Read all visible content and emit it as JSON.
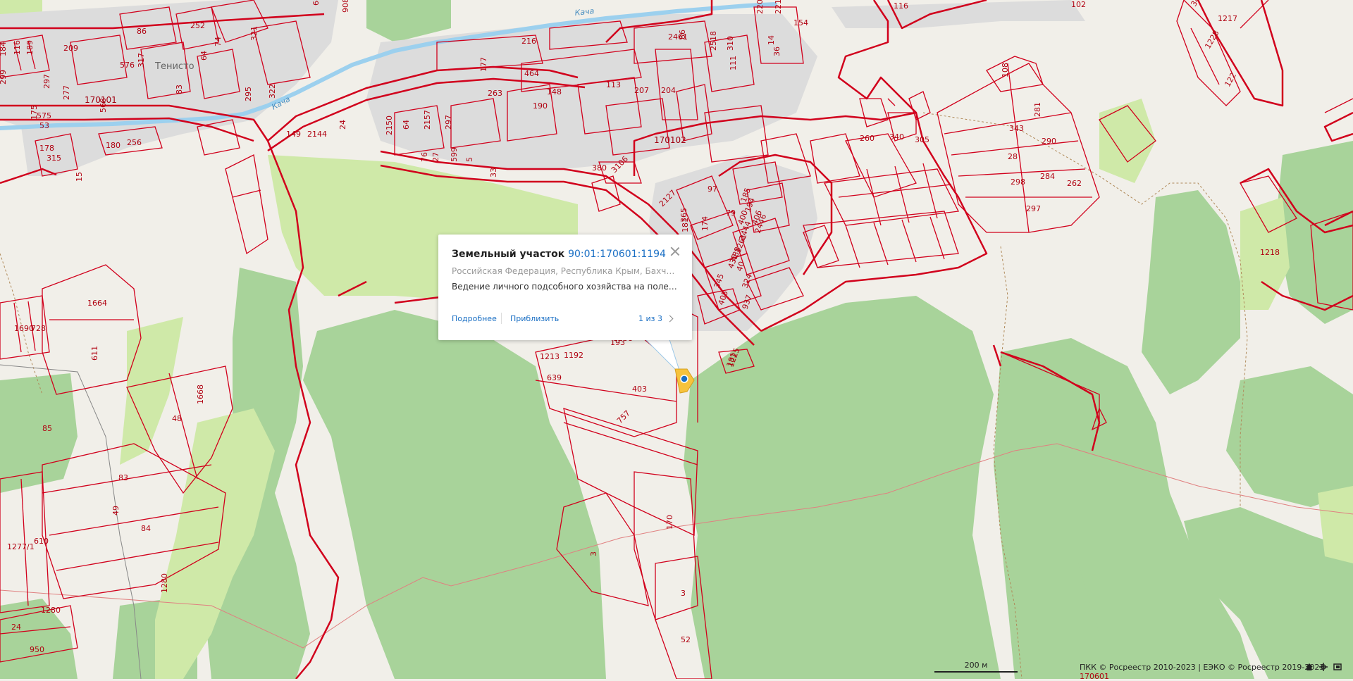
{
  "popup": {
    "title": "Земельный участок",
    "cadastral_number": "90:01:170601:1194",
    "address": "Российская Федерация, Республика Крым, Бахчисар...",
    "usage": "Ведение личного подсобного хозяйства на полевых...",
    "details_link": "Подробнее",
    "zoom_link": "Приблизить",
    "pager": "1 из 3"
  },
  "scale": {
    "label": "200 м"
  },
  "copyright": "ПКК © Росреестр 2010-2023 | ЕЭКО © Росреестр 2019-2023",
  "place_names": [
    "Тенисто"
  ],
  "river_names": [
    "Кача",
    "Кача"
  ],
  "quarter_labels": [
    "170101",
    "170102",
    "170601"
  ],
  "parcel_labels": [
    "68",
    "908",
    "116",
    "102",
    "252",
    "86",
    "209",
    "576",
    "317",
    "321",
    "74",
    "64",
    "83",
    "322",
    "297",
    "299",
    "184",
    "116",
    "189",
    "568",
    "277",
    "295",
    "175",
    "575",
    "256",
    "180",
    "178",
    "315",
    "15",
    "2144",
    "149",
    "24",
    "2150",
    "64",
    "2157",
    "297",
    "76",
    "27",
    "599",
    "5",
    "33",
    "216",
    "464",
    "177",
    "263",
    "148",
    "190",
    "113",
    "207",
    "204",
    "53",
    "2461",
    "86",
    "2518",
    "310",
    "111",
    "14",
    "154",
    "36",
    "2211",
    "2206",
    "108",
    "281",
    "343",
    "290",
    "28",
    "284",
    "298",
    "262",
    "297",
    "260",
    "340",
    "305",
    "380",
    "3106",
    "2127",
    "365",
    "181",
    "174",
    "97",
    "79",
    "185",
    "194",
    "400",
    "406",
    "2446",
    "2444",
    "1261",
    "488",
    "435",
    "40",
    "345",
    "324",
    "405",
    "937",
    "181",
    "1225",
    "1213",
    "1192",
    "193",
    "1208",
    "639",
    "403",
    "757",
    "170",
    "3",
    "3",
    "52",
    "1664",
    "1690",
    "728",
    "611",
    "1668",
    "48",
    "85",
    "83",
    "49",
    "610",
    "84",
    "1277/1",
    "1280",
    "1280",
    "24",
    "950",
    "1218",
    "1217",
    "1228",
    "122",
    "346",
    "170601"
  ],
  "colors": {
    "background": "#f1efe9",
    "forest": "#a8d39a",
    "meadow": "#cfe9a8",
    "settlement": "#dcdcdc",
    "parcel_boundary": "#d1001c",
    "water": "#9cd0ee",
    "link": "#1a6fc4",
    "marker": "#f7c33c"
  },
  "icons": {
    "close": "close-icon",
    "next": "chevron-right-icon",
    "home": "home-icon",
    "locate": "crosshair-icon",
    "fullscreen": "expand-icon",
    "marker": "map-marker-icon"
  }
}
